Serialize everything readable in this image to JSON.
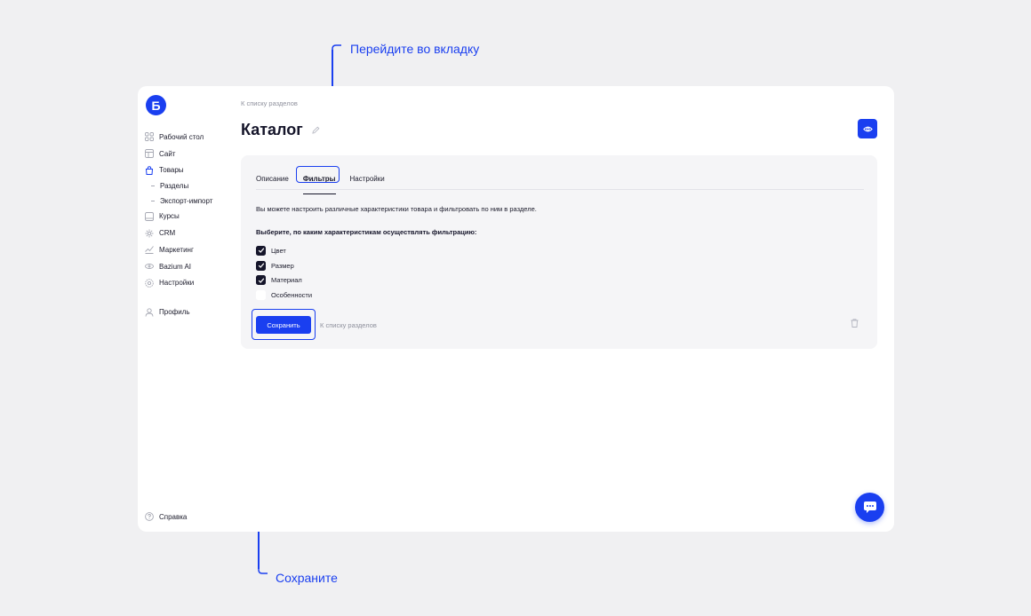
{
  "annotations": {
    "top": "Перейдите во вкладку",
    "bottom": "Сохраните"
  },
  "logo": {
    "letter": "Б"
  },
  "sidebar": {
    "items": [
      {
        "label": "Рабочий стол",
        "icon": "dashboard-icon"
      },
      {
        "label": "Сайт",
        "icon": "site-icon"
      },
      {
        "label": "Товары",
        "icon": "bag-icon",
        "active": true
      },
      {
        "label": "Курсы",
        "icon": "courses-icon"
      },
      {
        "label": "CRM",
        "icon": "crm-icon"
      },
      {
        "label": "Маркетинг",
        "icon": "marketing-icon"
      },
      {
        "label": "Bazium AI",
        "icon": "ai-icon"
      },
      {
        "label": "Настройки",
        "icon": "settings-icon"
      }
    ],
    "subitems": [
      {
        "label": "Разделы"
      },
      {
        "label": "Экспорт-импорт"
      }
    ],
    "profile": "Профиль",
    "help": "Справка"
  },
  "header": {
    "breadcrumb": "К списку разделов",
    "title": "Каталог"
  },
  "tabs": [
    {
      "label": "Описание"
    },
    {
      "label": "Фильтры",
      "active": true
    },
    {
      "label": "Настройки"
    }
  ],
  "content": {
    "description": "Вы можете настроить различные характеристики товара и фильтровать по ним в разделе.",
    "subheading": "Выберите, по каким характеристикам осуществлять фильтрацию:",
    "checkboxes": [
      {
        "label": "Цвет",
        "checked": true
      },
      {
        "label": "Размер",
        "checked": true
      },
      {
        "label": "Материал",
        "checked": true
      },
      {
        "label": "Особенности",
        "checked": false
      }
    ],
    "save_label": "Сохранить",
    "back_label": "К списку разделов"
  },
  "colors": {
    "accent": "#1a3ff0",
    "background": "#f0f0f2",
    "panel": "#f5f5f7",
    "text": "#1b1b2b",
    "muted": "#8e909c"
  }
}
